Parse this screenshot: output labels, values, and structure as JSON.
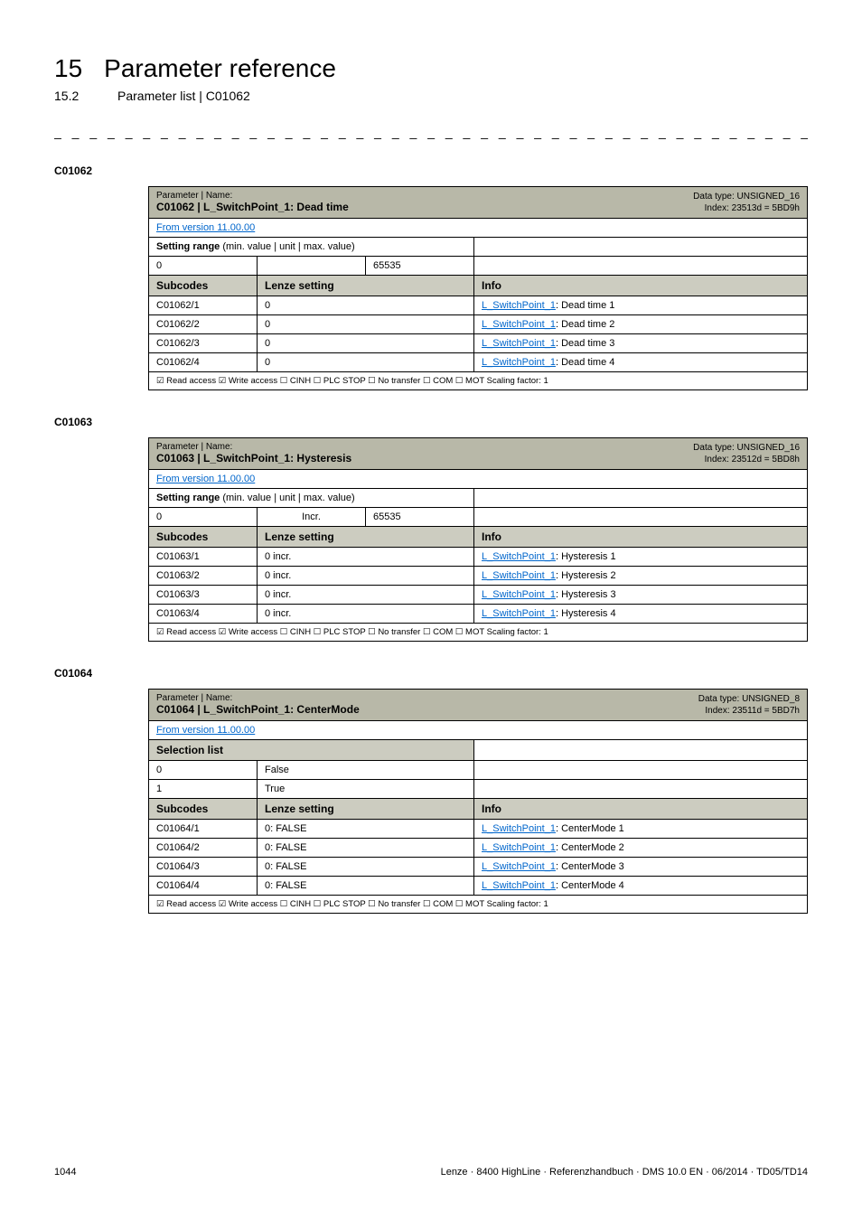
{
  "header": {
    "chapter_num": "15",
    "chapter_title": "Parameter reference",
    "sub_num": "15.2",
    "sub_title": "Parameter list | C01062",
    "dashes": "_ _ _ _ _ _ _ _ _ _ _ _ _ _ _ _ _ _ _ _ _ _ _ _ _ _ _ _ _ _ _ _ _ _ _ _ _ _ _ _ _ _ _ _ _ _ _ _ _ _ _ _ _ _ _ _ _ _ _ _ _ _ _ _"
  },
  "tables": {
    "t1": {
      "section": "C01062",
      "param_label": "Parameter | Name:",
      "param_name": "C01062 | L_SwitchPoint_1: Dead time",
      "dtype": "Data type: UNSIGNED_16",
      "index": "Index: 23513d = 5BD9h",
      "version": "From version 11.00.00",
      "setting_range": "Setting range",
      "setting_sub": "(min. value | unit | max. value)",
      "min": "0",
      "max": "65535",
      "sub_h": "Subcodes",
      "lenze_h": "Lenze setting",
      "info_h": "Info",
      "rows": [
        {
          "c": "C01062/1",
          "s": "0",
          "l": "L_SwitchPoint_1",
          "r": ": Dead time 1"
        },
        {
          "c": "C01062/2",
          "s": "0",
          "l": "L_SwitchPoint_1",
          "r": ": Dead time 2"
        },
        {
          "c": "C01062/3",
          "s": "0",
          "l": "L_SwitchPoint_1",
          "r": ": Dead time 3"
        },
        {
          "c": "C01062/4",
          "s": "0",
          "l": "L_SwitchPoint_1",
          "r": ": Dead time 4"
        }
      ],
      "footer": "☑ Read access   ☑ Write access   ☐ CINH   ☐ PLC STOP   ☐ No transfer   ☐ COM   ☐ MOT     Scaling factor: 1"
    },
    "t2": {
      "section": "C01063",
      "param_label": "Parameter | Name:",
      "param_name": "C01063 | L_SwitchPoint_1: Hysteresis",
      "dtype": "Data type: UNSIGNED_16",
      "index": "Index: 23512d = 5BD8h",
      "version": "From version 11.00.00",
      "setting_range": "Setting range",
      "setting_sub": "(min. value | unit | max. value)",
      "min": "0",
      "unit": "Incr.",
      "max": "65535",
      "sub_h": "Subcodes",
      "lenze_h": "Lenze setting",
      "info_h": "Info",
      "rows": [
        {
          "c": "C01063/1",
          "s": "0 incr.",
          "l": "L_SwitchPoint_1",
          "r": ": Hysteresis 1"
        },
        {
          "c": "C01063/2",
          "s": "0 incr.",
          "l": "L_SwitchPoint_1",
          "r": ": Hysteresis 2"
        },
        {
          "c": "C01063/3",
          "s": "0 incr.",
          "l": "L_SwitchPoint_1",
          "r": ": Hysteresis 3"
        },
        {
          "c": "C01063/4",
          "s": "0 incr.",
          "l": "L_SwitchPoint_1",
          "r": ": Hysteresis 4"
        }
      ],
      "footer": "☑ Read access   ☑ Write access   ☐ CINH   ☐ PLC STOP   ☐ No transfer   ☐ COM   ☐ MOT     Scaling factor: 1"
    },
    "t3": {
      "section": "C01064",
      "param_label": "Parameter | Name:",
      "param_name": "C01064 | L_SwitchPoint_1: CenterMode",
      "dtype": "Data type: UNSIGNED_8",
      "index": "Index: 23511d = 5BD7h",
      "version": "From version 11.00.00",
      "selection": "Selection list",
      "sel_rows": [
        {
          "n": "0",
          "v": "False"
        },
        {
          "n": "1",
          "v": "True"
        }
      ],
      "sub_h": "Subcodes",
      "lenze_h": "Lenze setting",
      "info_h": "Info",
      "rows": [
        {
          "c": "C01064/1",
          "s": "0: FALSE",
          "l": "L_SwitchPoint_1",
          "r": ": CenterMode 1"
        },
        {
          "c": "C01064/2",
          "s": "0: FALSE",
          "l": "L_SwitchPoint_1",
          "r": ": CenterMode 2"
        },
        {
          "c": "C01064/3",
          "s": "0: FALSE",
          "l": "L_SwitchPoint_1",
          "r": ": CenterMode 3"
        },
        {
          "c": "C01064/4",
          "s": "0: FALSE",
          "l": "L_SwitchPoint_1",
          "r": ": CenterMode 4"
        }
      ],
      "footer": "☑ Read access   ☑ Write access   ☐ CINH   ☐ PLC STOP   ☐ No transfer   ☐ COM   ☐ MOT     Scaling factor: 1"
    }
  },
  "footer": {
    "page": "1044",
    "ref": "Lenze · 8400 HighLine · Referenzhandbuch · DMS 10.0 EN · 06/2014 · TD05/TD14"
  }
}
